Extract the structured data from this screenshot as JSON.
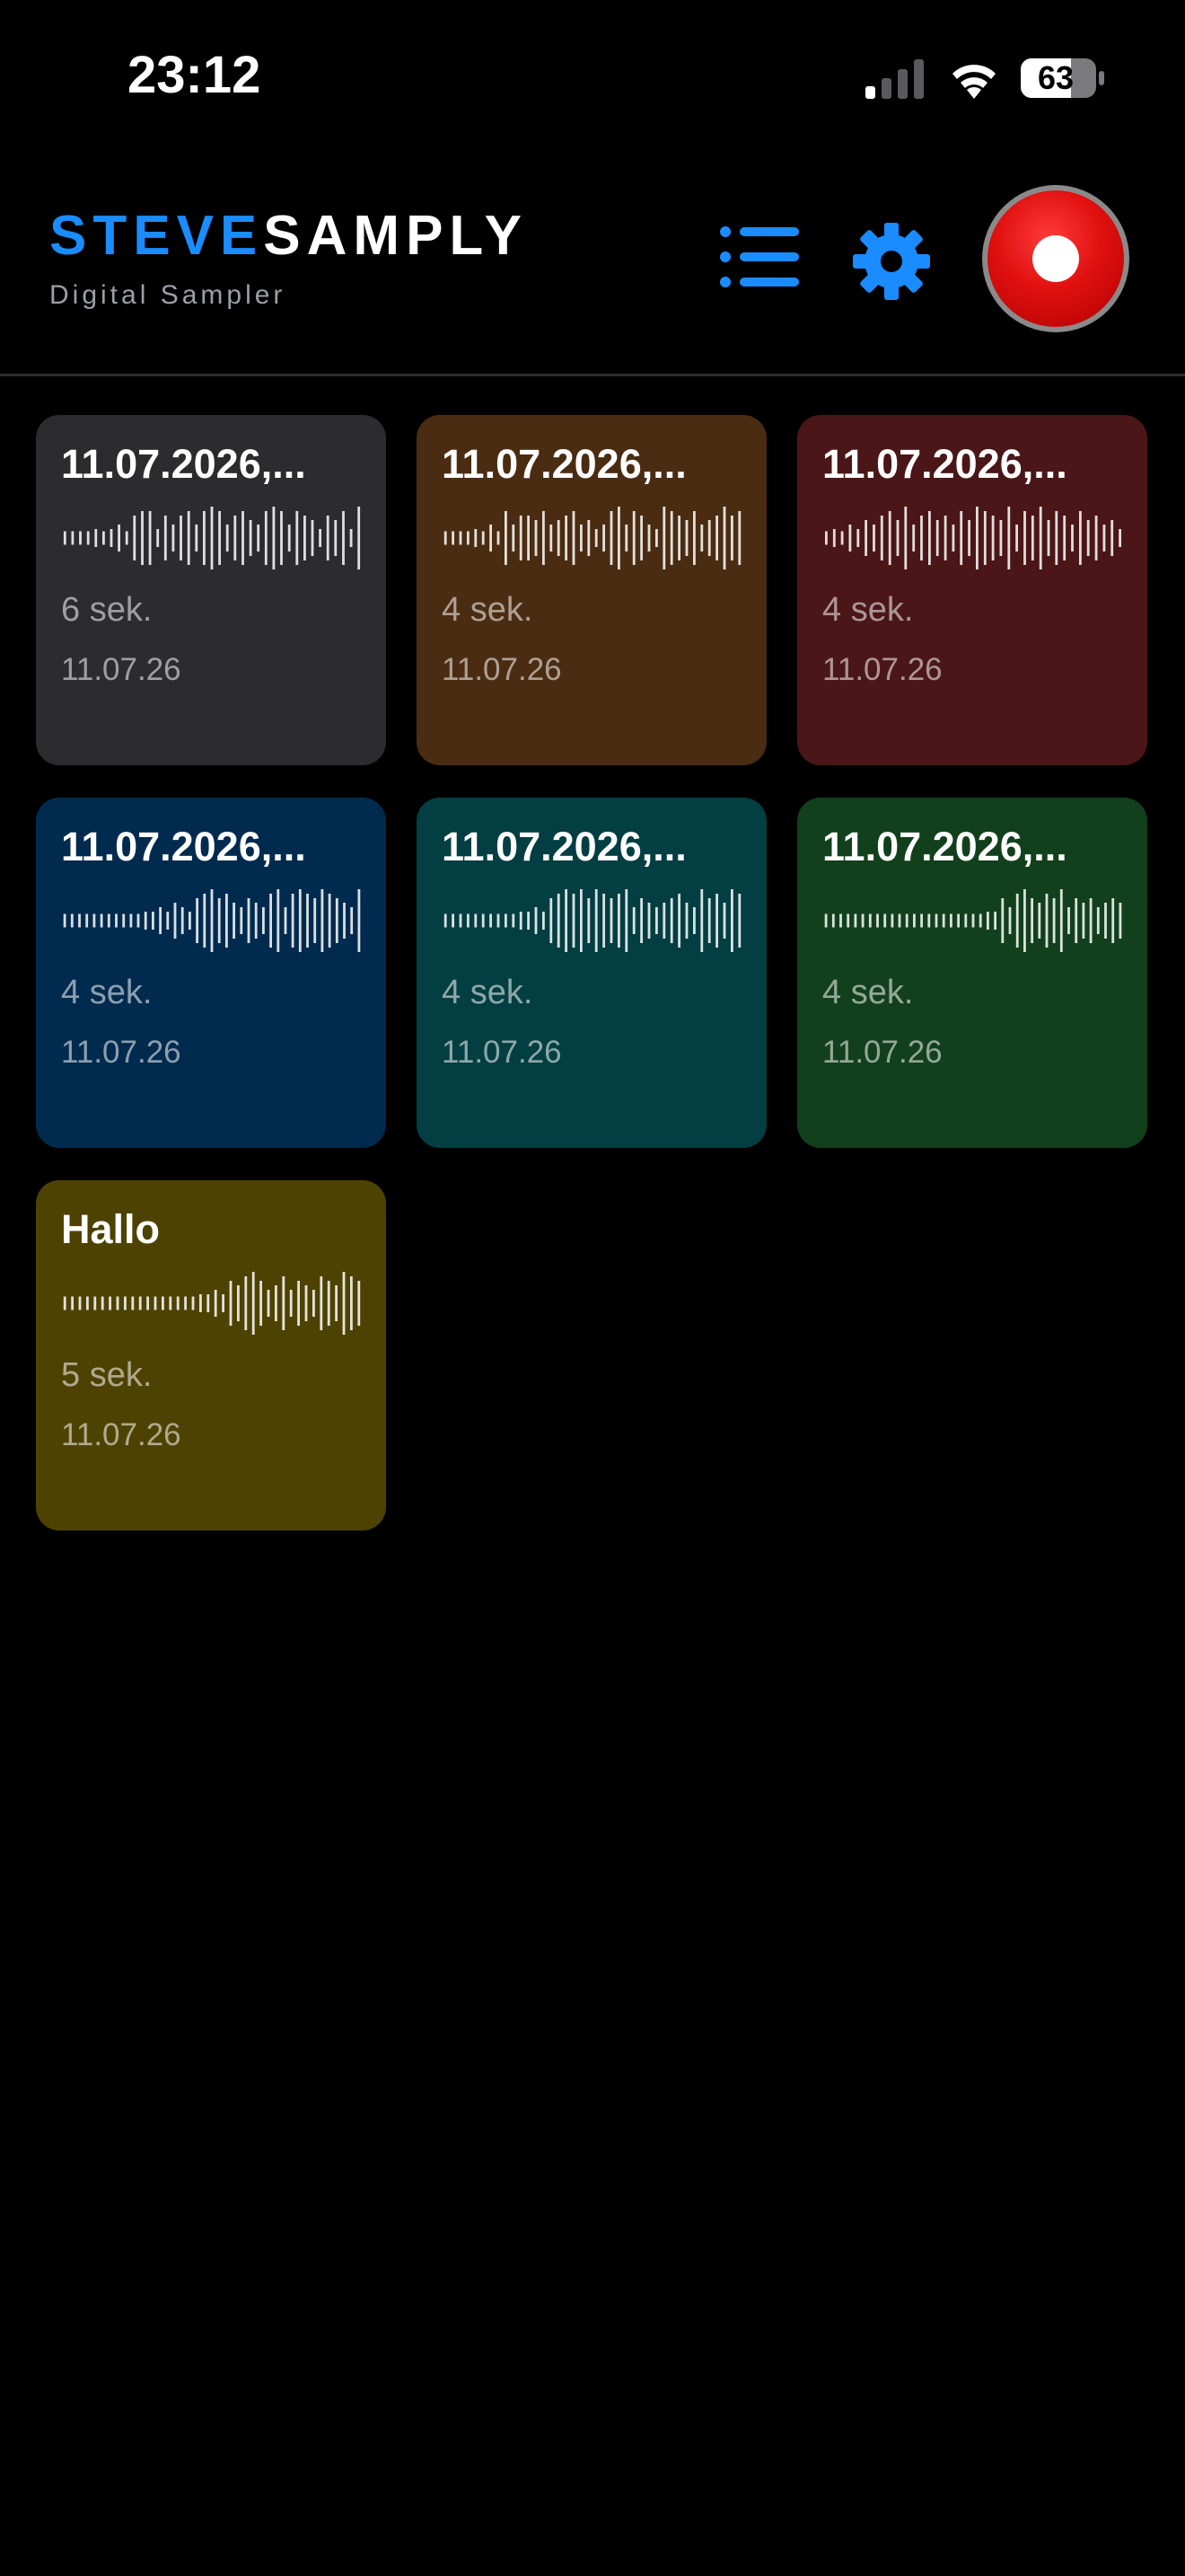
{
  "status_bar": {
    "time": "23:12",
    "battery": "63"
  },
  "header": {
    "logo_part1": "STEVE",
    "logo_part2": "SAMPLY",
    "subtitle": "Digital Sampler",
    "accent_color": "#1a8cff",
    "record_color": "#e01010"
  },
  "samples": [
    {
      "title": "11.07.2026,...",
      "duration": "6 sek.",
      "date": "11.07.26",
      "color": "#2c2c2e",
      "wave": [
        3,
        3,
        3,
        3,
        4,
        3,
        4,
        6,
        3,
        10,
        12,
        12,
        4,
        10,
        6,
        10,
        12,
        6,
        12,
        14,
        12,
        6,
        10,
        12,
        8,
        6,
        12,
        14,
        12,
        6,
        12,
        10,
        8,
        4,
        10,
        8,
        12,
        4,
        14
      ]
    },
    {
      "title": "11.07.2026,...",
      "duration": "4 sek.",
      "date": "11.07.26",
      "color": "#4a2c12",
      "wave": [
        3,
        3,
        3,
        3,
        4,
        3,
        6,
        3,
        12,
        6,
        10,
        10,
        8,
        12,
        6,
        8,
        10,
        12,
        6,
        8,
        4,
        6,
        12,
        14,
        6,
        12,
        10,
        6,
        4,
        14,
        12,
        10,
        8,
        12,
        6,
        8,
        10,
        14,
        10,
        12
      ]
    },
    {
      "title": "11.07.2026,...",
      "duration": "4 sek.",
      "date": "11.07.26",
      "color": "#4a1618",
      "wave": [
        3,
        4,
        3,
        6,
        4,
        8,
        6,
        10,
        12,
        8,
        14,
        6,
        10,
        12,
        8,
        10,
        6,
        12,
        8,
        14,
        12,
        10,
        8,
        14,
        6,
        12,
        10,
        14,
        8,
        12,
        10,
        6,
        12,
        8,
        10,
        6,
        8,
        4
      ]
    },
    {
      "title": "11.07.2026,...",
      "duration": "4 sek.",
      "date": "11.07.26",
      "color": "#002a4e",
      "wave": [
        3,
        3,
        3,
        3,
        3,
        3,
        3,
        3,
        3,
        3,
        3,
        4,
        4,
        6,
        4,
        8,
        6,
        4,
        10,
        12,
        14,
        10,
        12,
        8,
        6,
        10,
        8,
        6,
        12,
        14,
        6,
        12,
        14,
        12,
        10,
        14,
        12,
        10,
        8,
        6,
        14
      ]
    },
    {
      "title": "11.07.2026,...",
      "duration": "4 sek.",
      "date": "11.07.26",
      "color": "#033e42",
      "wave": [
        3,
        3,
        3,
        3,
        3,
        3,
        3,
        3,
        3,
        3,
        4,
        4,
        6,
        4,
        10,
        12,
        14,
        12,
        14,
        10,
        14,
        12,
        10,
        12,
        14,
        6,
        10,
        8,
        6,
        8,
        10,
        12,
        8,
        6,
        14,
        10,
        12,
        8,
        14,
        12
      ]
    },
    {
      "title": "11.07.2026,...",
      "duration": "4 sek.",
      "date": "11.07.26",
      "color": "#12401c",
      "wave": [
        3,
        3,
        3,
        3,
        3,
        3,
        3,
        3,
        3,
        3,
        3,
        3,
        3,
        3,
        3,
        3,
        3,
        3,
        3,
        3,
        3,
        3,
        4,
        4,
        10,
        6,
        12,
        14,
        10,
        8,
        12,
        10,
        14,
        6,
        10,
        8,
        10,
        6,
        8,
        10,
        8
      ]
    },
    {
      "title": "Hallo",
      "duration": "5 sek.",
      "date": "11.07.26",
      "color": "#4e4202",
      "wave": [
        3,
        3,
        3,
        3,
        3,
        3,
        3,
        3,
        3,
        3,
        3,
        3,
        3,
        3,
        3,
        3,
        3,
        3,
        4,
        4,
        6,
        4,
        10,
        8,
        12,
        14,
        10,
        6,
        8,
        12,
        6,
        10,
        8,
        6,
        12,
        10,
        8,
        14,
        12,
        10
      ]
    }
  ]
}
